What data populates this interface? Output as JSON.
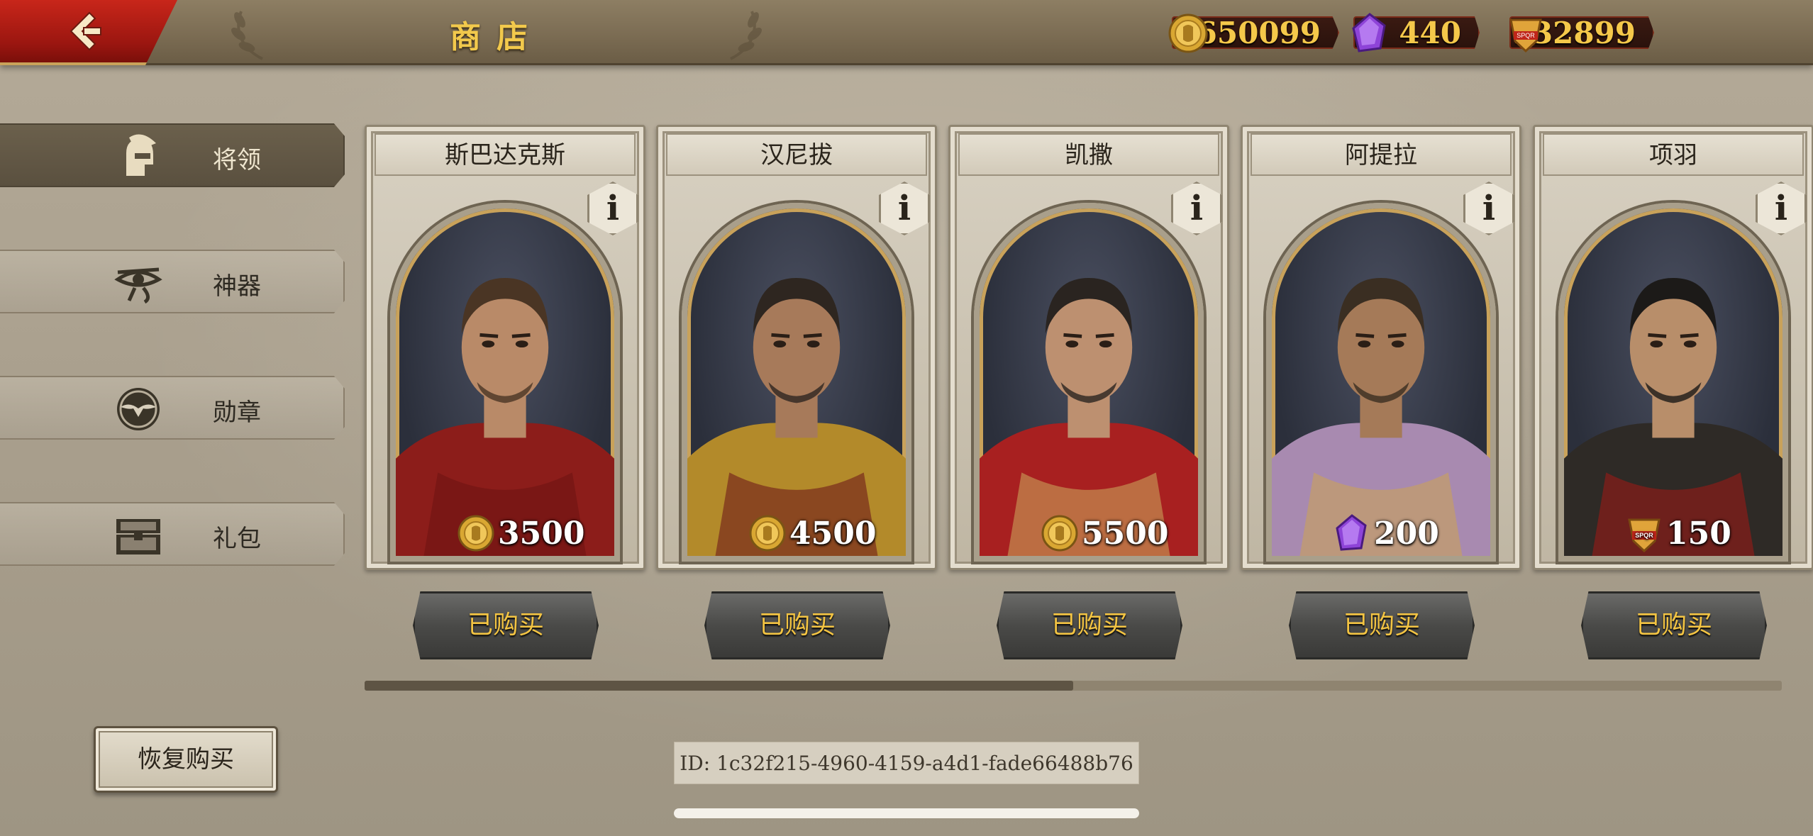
{
  "header": {
    "title": "商店",
    "back_icon": "chevron-left-icon"
  },
  "currencies": [
    {
      "name": "gold-coin",
      "value": "650099",
      "color": "#f5c84a"
    },
    {
      "name": "purple-gem",
      "value": "440",
      "color": "#8e44d8"
    },
    {
      "name": "spqr-token",
      "value": "132899",
      "color": "#e0a43a"
    }
  ],
  "sidebar": {
    "items": [
      {
        "label": "将领",
        "icon": "spartan-helmet-icon",
        "active": true
      },
      {
        "label": "神器",
        "icon": "eye-of-horus-icon",
        "active": false
      },
      {
        "label": "勋章",
        "icon": "eagle-medal-icon",
        "active": false
      },
      {
        "label": "礼包",
        "icon": "treasure-chest-icon",
        "active": false
      }
    ]
  },
  "cards": [
    {
      "name": "斯巴达克斯",
      "price": "3500",
      "currency": "gold-coin",
      "button": "已购买"
    },
    {
      "name": "汉尼拔",
      "price": "4500",
      "currency": "gold-coin",
      "button": "已购买"
    },
    {
      "name": "凯撒",
      "price": "5500",
      "currency": "gold-coin",
      "button": "已购买"
    },
    {
      "name": "阿提拉",
      "price": "200",
      "currency": "purple-gem",
      "button": "已购买"
    },
    {
      "name": "项羽",
      "price": "150",
      "currency": "spqr-token",
      "button": "已购买"
    }
  ],
  "scroll_progress": 0.5,
  "footer": {
    "restore_label": "恢复购买",
    "id_text": "ID: 1c32f215-4960-4159-a4d1-fade66488b76"
  }
}
